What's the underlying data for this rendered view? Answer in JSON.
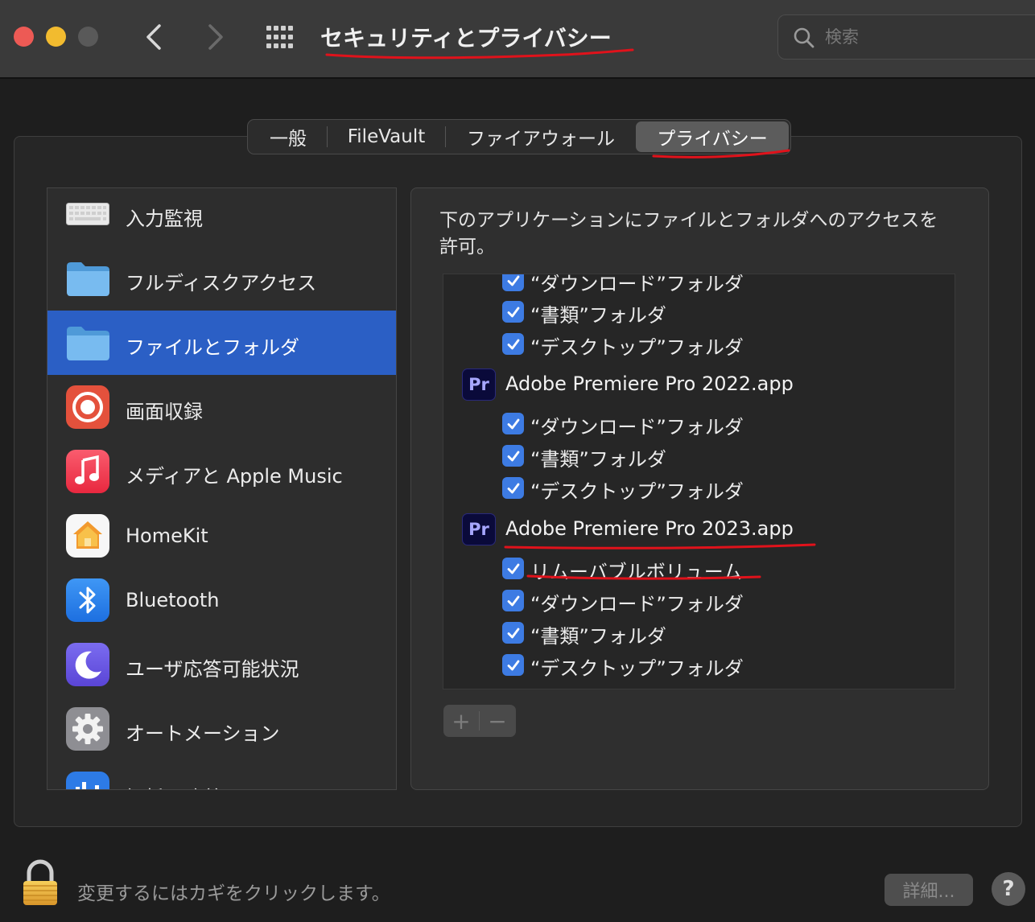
{
  "window": {
    "title": "セキュリティとプライバシー",
    "search_placeholder": "検索"
  },
  "tabs": [
    {
      "label": "一般",
      "active": false
    },
    {
      "label": "FileVault",
      "active": false
    },
    {
      "label": "ファイアウォール",
      "active": false
    },
    {
      "label": "プライバシー",
      "active": true
    }
  ],
  "sidebar": {
    "items": [
      {
        "label": "入力監視",
        "icon": "keyboard-icon"
      },
      {
        "label": "フルディスクアクセス",
        "icon": "folder-icon"
      },
      {
        "label": "ファイルとフォルダ",
        "icon": "folder-icon",
        "selected": true
      },
      {
        "label": "画面収録",
        "icon": "screen-record-icon"
      },
      {
        "label": "メディアと Apple Music",
        "icon": "music-icon"
      },
      {
        "label": "HomeKit",
        "icon": "home-icon"
      },
      {
        "label": "Bluetooth",
        "icon": "bluetooth-icon"
      },
      {
        "label": "ユーザ応答可能状況",
        "icon": "moon-icon"
      },
      {
        "label": "オートメーション",
        "icon": "gear-icon"
      },
      {
        "label": "解析と改善",
        "icon": "analytics-icon"
      }
    ]
  },
  "pane": {
    "description": "下のアプリケーションにファイルとフォルダへのアクセスを許可。",
    "list": {
      "partial_rows": [
        {
          "label": "“ダウンロード”フォルダ",
          "checked": true
        },
        {
          "label": "“書類”フォルダ",
          "checked": true
        },
        {
          "label": "“デスクトップ”フォルダ",
          "checked": true
        }
      ],
      "apps": [
        {
          "icon_text": "Pr",
          "name": "Adobe Premiere Pro 2022.app",
          "rows": [
            {
              "label": "“ダウンロード”フォルダ",
              "checked": true
            },
            {
              "label": "“書類”フォルダ",
              "checked": true
            },
            {
              "label": "“デスクトップ”フォルダ",
              "checked": true
            }
          ]
        },
        {
          "icon_text": "Pr",
          "name": "Adobe Premiere Pro 2023.app",
          "rows": [
            {
              "label": "リムーバブルボリューム",
              "checked": true
            },
            {
              "label": "“ダウンロード”フォルダ",
              "checked": true
            },
            {
              "label": "“書類”フォルダ",
              "checked": true
            },
            {
              "label": "“デスクトップ”フォルダ",
              "checked": true
            }
          ]
        }
      ]
    },
    "add_label": "+",
    "remove_label": "−"
  },
  "footer": {
    "lock_text": "変更するにはカギをクリックします。",
    "details_label": "詳細...",
    "help_label": "?"
  },
  "colors": {
    "accent": "#3d7be3",
    "selection": "#2b5fc5",
    "annotation": "#e0121b"
  }
}
